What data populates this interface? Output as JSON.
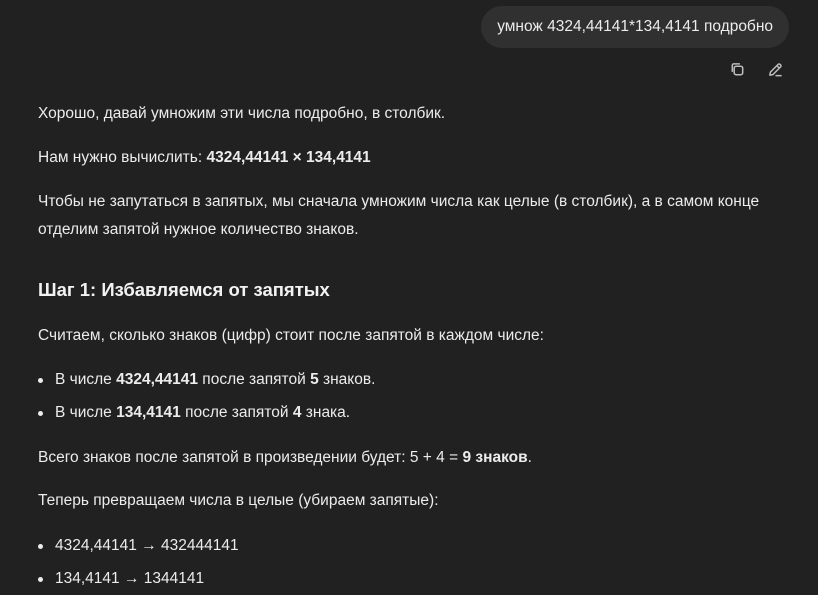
{
  "user_message": {
    "text": "умнож 4324,44141*134,4141 подробно"
  },
  "message_actions": [
    {
      "icon": "copy-icon"
    },
    {
      "icon": "edit-icon"
    }
  ],
  "answer": {
    "intro": "Хорошо, давай умножим эти числа подробно, в столбик.",
    "need_prefix": "Нам нужно вычислить: ",
    "need_expr": "4324,44141 × 134,4141",
    "plan_line1": "Чтобы не запутаться в запятых, мы сначала умножим числа как целые (в столбик), а в самом конце",
    "plan_line2": "отделим запятой нужное количество знаков.",
    "step1_heading": "Шаг 1: Избавляемся от запятых",
    "count_intro": "Считаем, сколько знаков (цифр) стоит после запятой в каждом числе:",
    "bullets": [
      {
        "pre": "В числе ",
        "num": "4324,44141",
        "mid": " после запятой ",
        "count": "5",
        "post": " знаков."
      },
      {
        "pre": "В числе ",
        "num": "134,4141",
        "mid": " после запятой ",
        "count": "4",
        "post": " знака."
      }
    ],
    "total_prefix": "Всего знаков после запятой в произведении будет: 5 + 4 = ",
    "total_bold": "9 знаков",
    "total_suffix": ".",
    "convert_intro": "Теперь превращаем числа в целые (убираем запятые):",
    "conversions": [
      "4324,44141 → 432444141",
      "134,4141 → 1344141"
    ]
  }
}
